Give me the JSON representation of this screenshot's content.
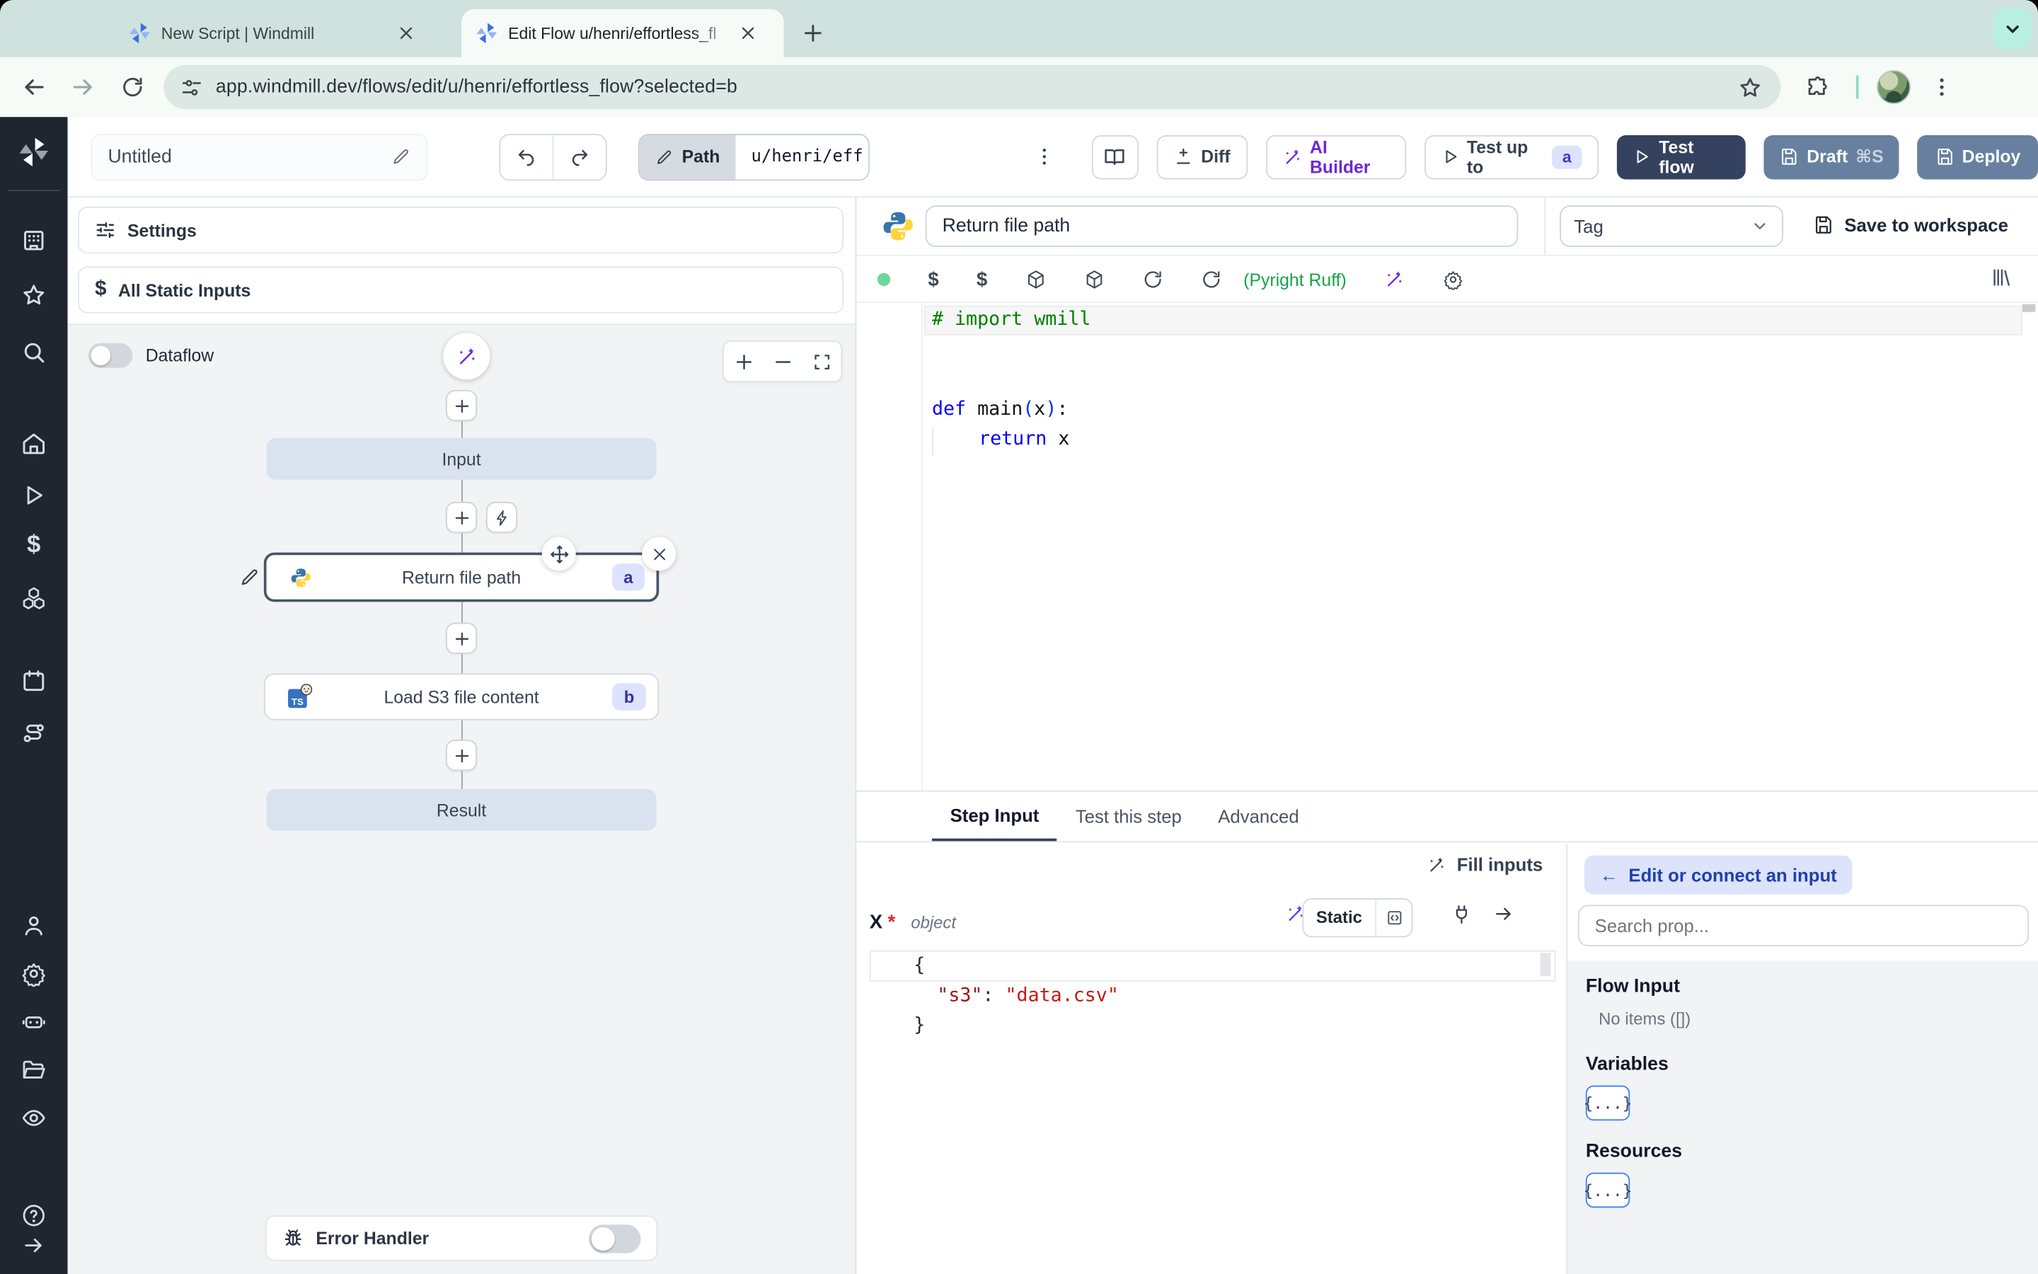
{
  "browser": {
    "tab1_title": "New Script | Windmill",
    "tab2_title": "Edit Flow u/henri/effortless_fl",
    "url": "app.windmill.dev/flows/edit/u/henri/effortless_flow?selected=b"
  },
  "header": {
    "flow_name": "Untitled",
    "path_label": "Path",
    "path_value": "u/henri/eff",
    "diff_label": "Diff",
    "ai_builder_label": "AI Builder",
    "test_up_to_label": "Test up to",
    "test_up_to_badge": "a",
    "test_flow_label": "Test flow",
    "draft_label": "Draft",
    "draft_shortcut": "⌘S",
    "deploy_label": "Deploy"
  },
  "flow_panel": {
    "settings_label": "Settings",
    "static_inputs_label": "All Static Inputs",
    "static_inputs_icon": "$",
    "dataflow_label": "Dataflow",
    "nodes": {
      "input": "Input",
      "step_a": {
        "title": "Return file path",
        "badge": "a"
      },
      "step_b": {
        "title": "Load S3 file content",
        "badge": "b",
        "lang_icon_text": "TS"
      },
      "result": "Result"
    },
    "error_handler_label": "Error Handler"
  },
  "step_editor": {
    "name_value": "Return file path",
    "tag_placeholder": "Tag",
    "save_label": "Save to workspace",
    "lint_status": "(Pyright Ruff)",
    "dollar_icon": "$",
    "code": {
      "l1": "# import wmill",
      "l4_kw": "def",
      "l4_name": " main",
      "l4_po": "(",
      "l4_arg": "x",
      "l4_pc": ")",
      "l4_colon": ":",
      "l5_kw": "return",
      "l5_rest": " x"
    }
  },
  "bottom": {
    "tabs": {
      "0": "Step Input",
      "1": "Test this step",
      "2": "Advanced"
    },
    "fill_inputs_label": "Fill inputs",
    "arg_name": "X",
    "arg_required": "*",
    "arg_type": "object",
    "static_label": "Static",
    "json": {
      "l1": "{",
      "l2_key": "\"s3\"",
      "l2_colon": ": ",
      "l2_val": "\"data.csv\"",
      "l3": "}"
    }
  },
  "right_col": {
    "connect_arrow": "←",
    "connect_label": "Edit or connect an input",
    "search_placeholder": "Search prop...",
    "flow_input_label": "Flow Input",
    "no_items": "No items ([])",
    "variables_label": "Variables",
    "resources_label": "Resources",
    "braces": "{...}"
  },
  "colors": {
    "accent_purple": "#6d28d9",
    "navy_button": "#35425f",
    "slate_button": "#68809f",
    "badge_bg": "#dde3fc",
    "badge_text": "#3730a3",
    "lint_green": "#16a34a"
  }
}
